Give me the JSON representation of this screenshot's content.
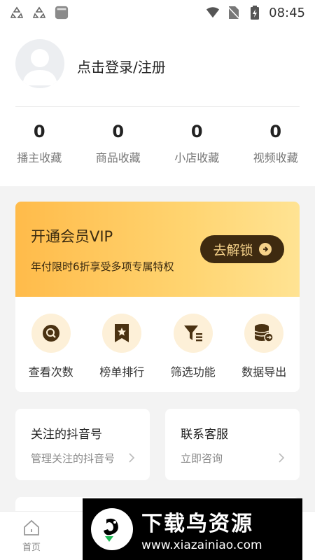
{
  "status_bar": {
    "time": "08:45"
  },
  "profile": {
    "login_text": "点击登录/注册",
    "stats": [
      {
        "value": "0",
        "label": "播主收藏"
      },
      {
        "value": "0",
        "label": "商品收藏"
      },
      {
        "value": "0",
        "label": "小店收藏"
      },
      {
        "value": "0",
        "label": "视频收藏"
      }
    ]
  },
  "vip": {
    "title": "开通会员VIP",
    "subtitle": "年付限时6折享受多项专属特权",
    "button": "去解锁",
    "features": [
      {
        "label": "查看次数",
        "icon": "search-icon"
      },
      {
        "label": "榜单排行",
        "icon": "star-bookmark-icon"
      },
      {
        "label": "筛选功能",
        "icon": "filter-icon"
      },
      {
        "label": "数据导出",
        "icon": "database-export-icon"
      }
    ]
  },
  "cards": {
    "follow": {
      "title": "关注的抖音号",
      "subtitle": "管理关注的抖音号"
    },
    "service": {
      "title": "联系客服",
      "subtitle": "立即咨询"
    }
  },
  "nav": {
    "home": "首页",
    "active_color": "#2ec46b"
  },
  "watermark": {
    "title": "下载鸟资源",
    "url": "www.xiazainiao.com"
  }
}
